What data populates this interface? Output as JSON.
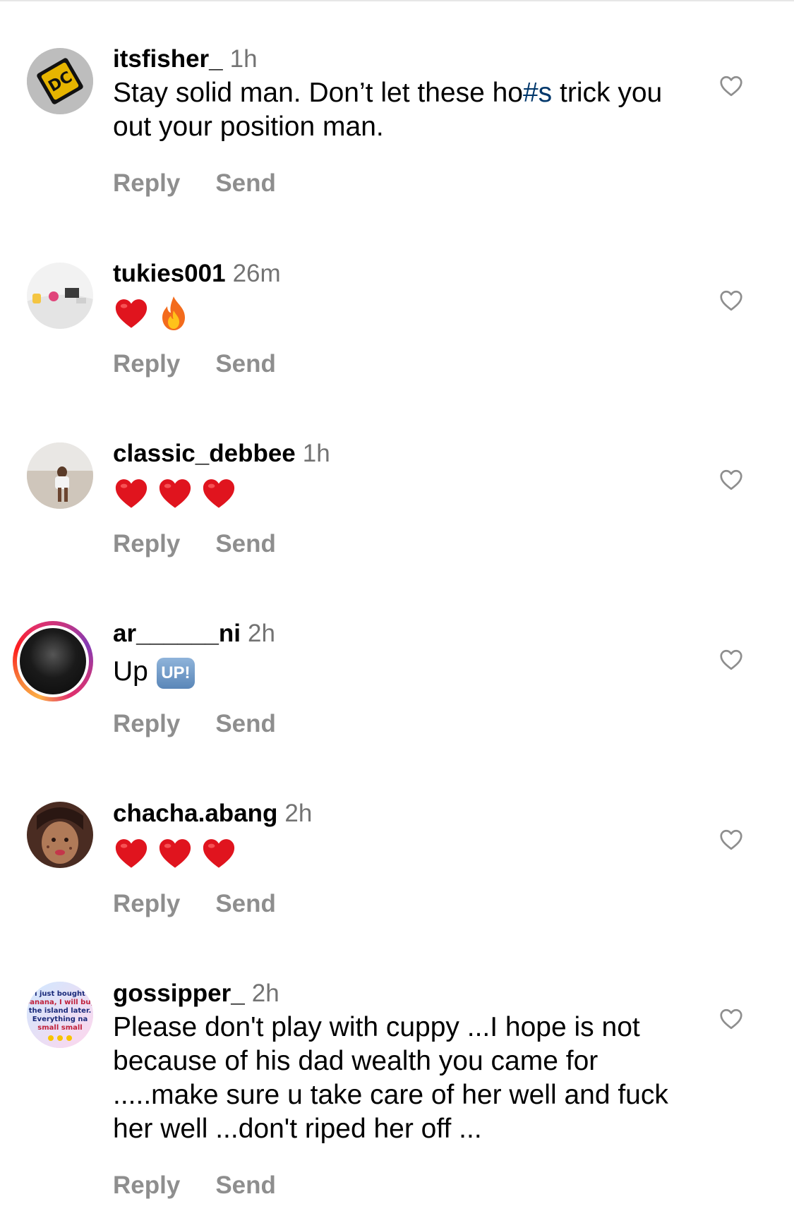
{
  "comments": [
    {
      "username": "itsfisher_",
      "time": "1h",
      "text_before": "Stay solid man. Don’t let these ho",
      "text_tag": "#s",
      "text_after": " trick you out your position man.",
      "reply": "Reply",
      "send": "Send"
    },
    {
      "username": "tukies001",
      "time": "26m",
      "emojis": [
        "red-heart",
        "fire"
      ],
      "reply": "Reply",
      "send": "Send"
    },
    {
      "username": "classic_debbee",
      "time": "1h",
      "emojis": [
        "red-heart",
        "red-heart",
        "red-heart"
      ],
      "reply": "Reply",
      "send": "Send"
    },
    {
      "username": "ar______ni",
      "time": "2h",
      "text": "Up",
      "badge": "UP!",
      "reply": "Reply",
      "send": "Send"
    },
    {
      "username": "chacha.abang",
      "time": "2h",
      "emojis": [
        "red-heart",
        "red-heart",
        "red-heart"
      ],
      "reply": "Reply",
      "send": "Send"
    },
    {
      "username": "gossipper_",
      "time": "2h",
      "text": "Please don't play with cuppy ...I hope is not because of his dad wealth you came for .....make sure u take care of her well and fuck her well ...don't riped her off ...",
      "reply": "Reply",
      "send": "Send",
      "avatar_text": "i just bought banana, I will buy the island later. Everything na small small"
    }
  ],
  "colors": {
    "username": "#000000",
    "time": "#737373",
    "actions": "#8e8e8e",
    "hashtag": "#00376b",
    "heart_outline": "#8e8e8e"
  }
}
